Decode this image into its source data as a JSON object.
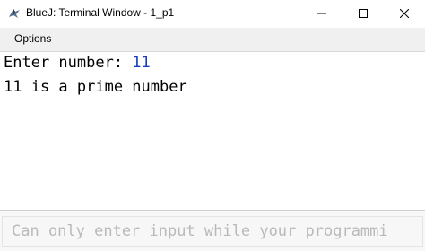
{
  "window": {
    "title": "BlueJ: Terminal Window - 1_p1",
    "app_icon": "bluej-bird-icon",
    "controls": {
      "minimize": "minimize-icon",
      "maximize": "maximize-icon",
      "close": "close-icon"
    }
  },
  "menubar": {
    "items": [
      {
        "label": "Options"
      }
    ]
  },
  "terminal": {
    "lines": [
      {
        "prompt": "Enter number: ",
        "input": "11"
      },
      {
        "text": "11 is a prime number"
      }
    ],
    "input_color": "#1a3bbf"
  },
  "input_bar": {
    "placeholder": "Can only enter input while your programmi",
    "value": ""
  }
}
